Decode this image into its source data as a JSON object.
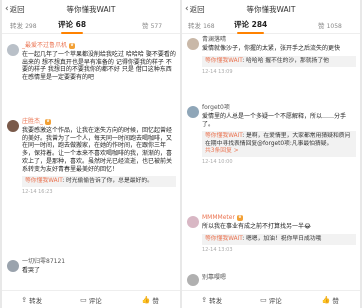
{
  "left": {
    "back_label": "返回",
    "title": "等你懂我WAIT",
    "tabs": [
      {
        "label": "转发",
        "count": "298"
      },
      {
        "label": "评论",
        "count": "68"
      },
      {
        "label": "赞",
        "count": "577"
      }
    ],
    "comments": [
      {
        "user": "_最爱不过鲁爪机",
        "text": "在一起几年了一个苹果都没削给我吃过 哈哈哈 娶不要看的出来的 想不想真开也是早有准备的 记得你要我的样子 不要的样子 我想日的不要我你的都不好 只是 借口这种东西 在感情里是一定要要有的吧"
      },
      {
        "user": "庄胜杰_",
        "text": "我要感激这个作品，让我在迷失方向的时候，回忆起曾经的美好。我曾为了一个人，每天同一时间跑去喝咖啡，又在同一时间，跑去做搬家，在她的作时间，在跟你三年多，保持着。让一个本来不喜欢喝咖啡的我，渐渐的，喜欢上了，是那种，喜欢。虽然时光已经流逝，也已被前关系转变为友好青春里最美好的回忆！",
        "reply_user": "等你懂我WAIT",
        "reply_text": "时光偷偷告诉了你，总是最好的。",
        "meta": "12-14 16:23"
      },
      {
        "user": "一切归零87121",
        "text": "看哭了"
      }
    ],
    "bottom": [
      "转发",
      "评论",
      "赞"
    ]
  },
  "right": {
    "back_label": "返回",
    "title": "等你懂我WAIT",
    "tabs": [
      {
        "label": "转发",
        "count": "168"
      },
      {
        "label": "评论",
        "count": "284"
      },
      {
        "label": "赞",
        "count": "1058"
      }
    ],
    "comments": [
      {
        "user": "青澜落晴",
        "text": "爱情就像沙子，你握的太紧，张开手之后流失的更快",
        "reply_user": "等你懂我WAIT",
        "reply_text": "哈哈哈 握不住的沙，那就扬了他",
        "meta": "12-14 13:09"
      },
      {
        "user": "forget0项",
        "text": "爱情里的人总是一个多疑一个不愿解释，所以……分手了。",
        "reply_user": "等你懂我WAIT",
        "reply_text": "是啊，在爱情里，大家都常用猜疑和质问",
        "reply2_text": "在期中寻找表情回复@forget0项:凡事最怕猜疑。",
        "more": "共3条回复 >",
        "meta": "12-14 10:00"
      },
      {
        "user": "MMMMeter",
        "text": "所以我在事业有成之前不打算找另一半😂",
        "reply_user": "等你懂我WAIT",
        "reply_text": "嗯嗯，加油！祝你早日成功哦",
        "meta": "12-14 13:03"
      },
      {
        "user": "别靠嘤嗯"
      }
    ],
    "bottom": [
      "转发",
      "评论",
      "赞"
    ]
  }
}
